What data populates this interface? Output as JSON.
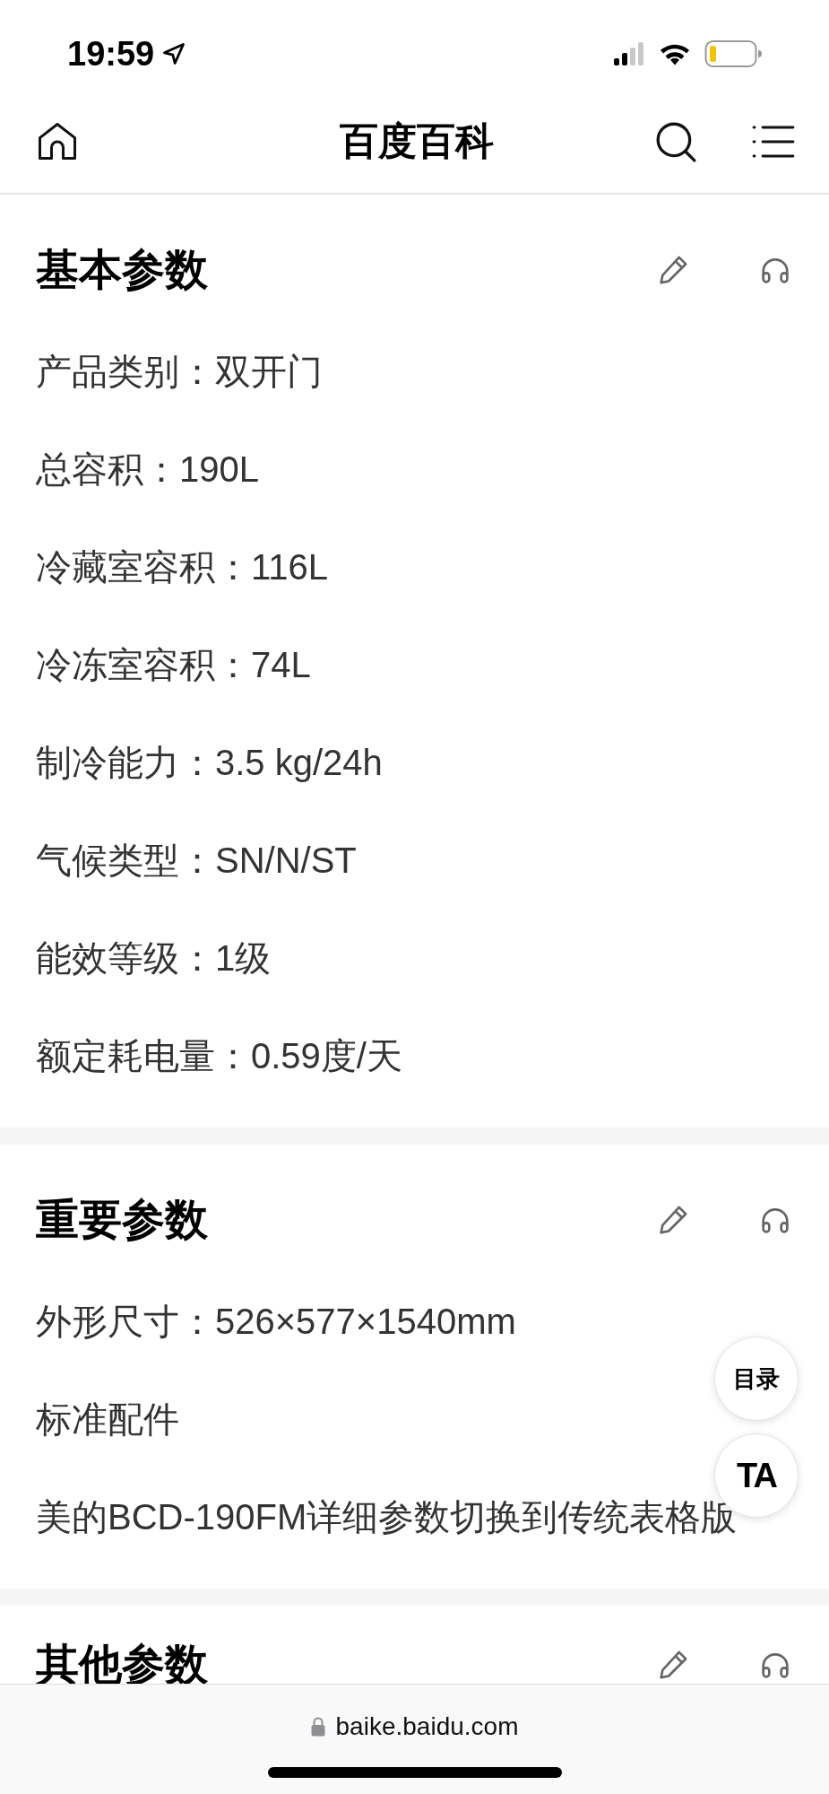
{
  "status_bar": {
    "time": "19:59"
  },
  "header": {
    "title": "百度百科"
  },
  "sections": [
    {
      "title": "基本参数",
      "rows": [
        "产品类别：双开门",
        "总容积：190L",
        "冷藏室容积：116L",
        "冷冻室容积：74L",
        "制冷能力：3.5 kg/24h",
        "气候类型：SN/N/ST",
        "能效等级：1级",
        "额定耗电量：0.59度/天"
      ]
    },
    {
      "title": "重要参数",
      "rows": [
        "外形尺寸：526×577×1540mm",
        "标准配件",
        "美的BCD-190FM详细参数切换到传统表格版"
      ]
    },
    {
      "title": "其他参数"
    }
  ],
  "floating_buttons": [
    {
      "kind": "text",
      "label": "目录"
    },
    {
      "kind": "logo",
      "label": "TA"
    }
  ],
  "address_bar": {
    "url": "baike.baidu.com"
  }
}
